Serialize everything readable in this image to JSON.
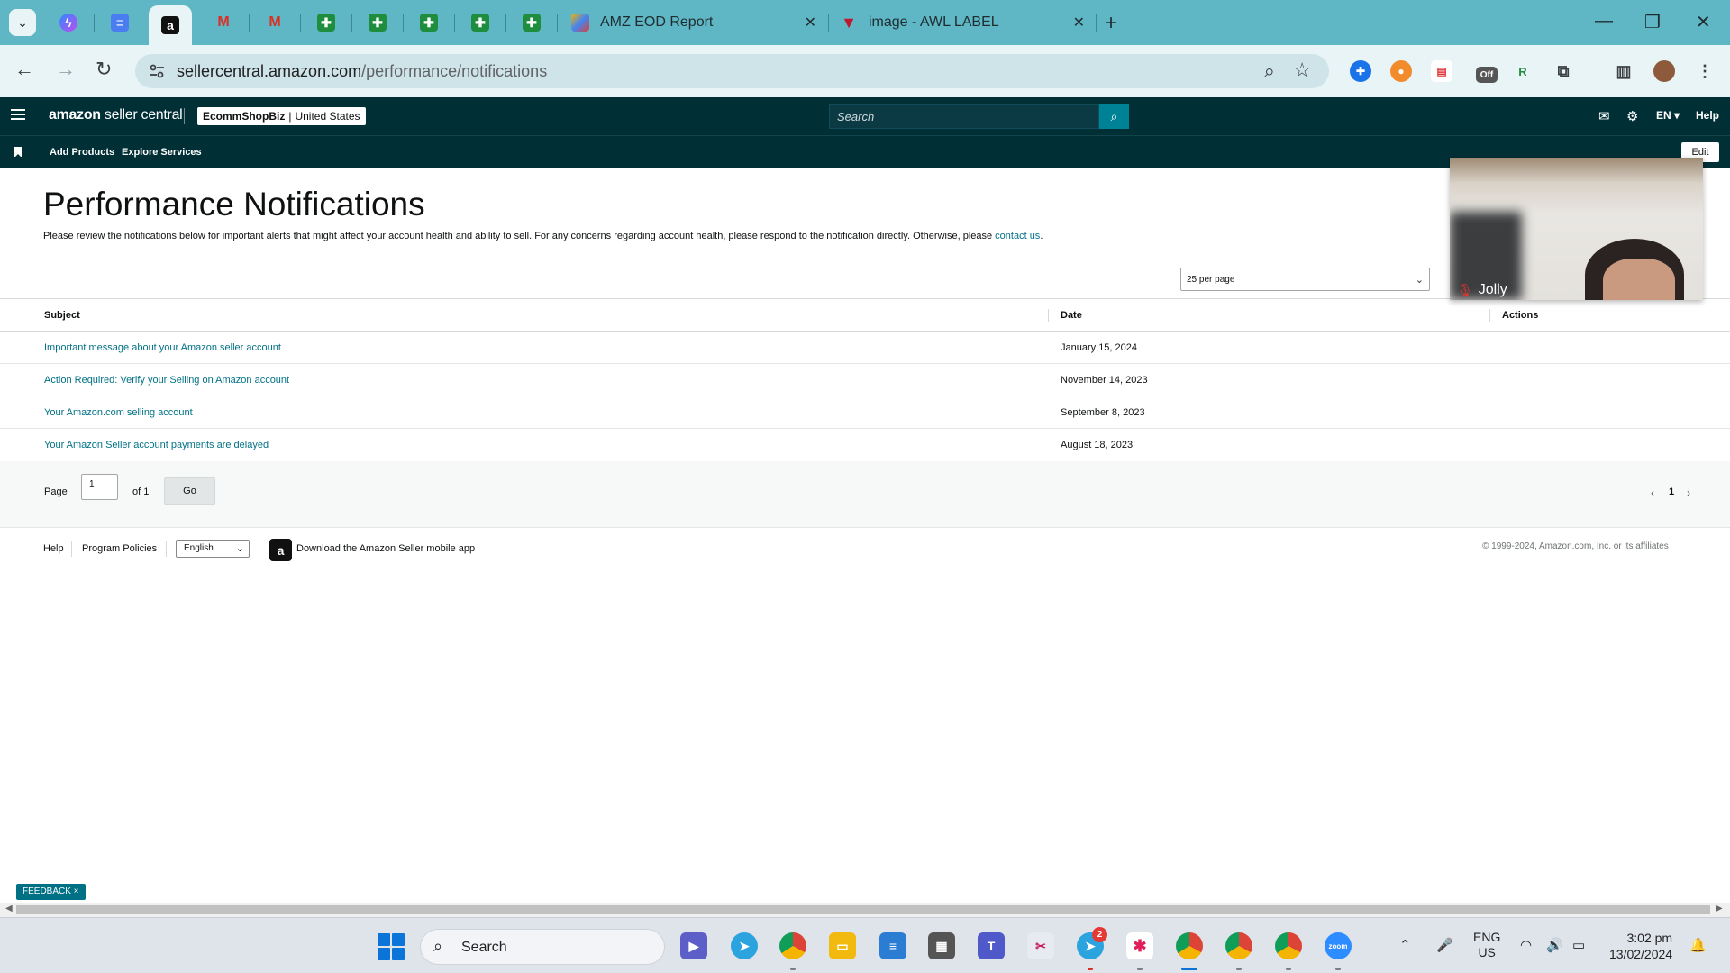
{
  "browser": {
    "tabs": [
      {
        "title": "AMZ EOD Report"
      },
      {
        "title": "image - AWL LABEL"
      }
    ],
    "url_host": "sellercentral.amazon.com",
    "url_path": "/performance/notifications",
    "extension_badge": "Off"
  },
  "header": {
    "logo_bold": "amazon",
    "logo_light": " seller central",
    "store_name": "EcommShopBiz",
    "store_divider": "|",
    "store_region": "United States",
    "search_placeholder": "Search",
    "language": "EN",
    "help": "Help"
  },
  "subnav": {
    "links": [
      "Add Products",
      "Explore Services"
    ],
    "edit": "Edit"
  },
  "page": {
    "title": "Performance Notifications",
    "intro": "Please review the notifications below for important alerts that might affect your account health and ability to sell. For any concerns regarding account health, please respond to the notification directly. Otherwise, please ",
    "intro_link": "contact us",
    "intro_end": ".",
    "per_page": "25 per page"
  },
  "table": {
    "headers": {
      "subject": "Subject",
      "date": "Date",
      "actions": "Actions"
    },
    "rows": [
      {
        "subject": "Important message about your Amazon seller account",
        "date": "January 15, 2024"
      },
      {
        "subject": "Action Required: Verify your Selling on Amazon account",
        "date": "November 14, 2023"
      },
      {
        "subject": "Your Amazon.com selling account",
        "date": "September 8, 2023"
      },
      {
        "subject": "Your Amazon Seller account payments are delayed",
        "date": "August 18, 2023"
      }
    ]
  },
  "pager": {
    "page_label": "Page",
    "current": "1",
    "of_label": "of 1",
    "go": "Go",
    "page_number": "1"
  },
  "footer": {
    "help": "Help",
    "policies": "Program Policies",
    "language": "English",
    "app_text": "Download the Amazon Seller mobile app",
    "copyright": "© 1999-2024, Amazon.com, Inc. or its affiliates"
  },
  "video": {
    "participant": "Jolly"
  },
  "feedback": "FEEDBACK ×",
  "taskbar": {
    "search": "Search",
    "telegram_badge": "2",
    "lang_top": "ENG",
    "lang_bottom": "US",
    "time": "3:02 pm",
    "date": "13/02/2024"
  },
  "colors": {
    "header_bg": "#002f36",
    "link": "#007185",
    "tabstrip": "#5fb6c4"
  }
}
